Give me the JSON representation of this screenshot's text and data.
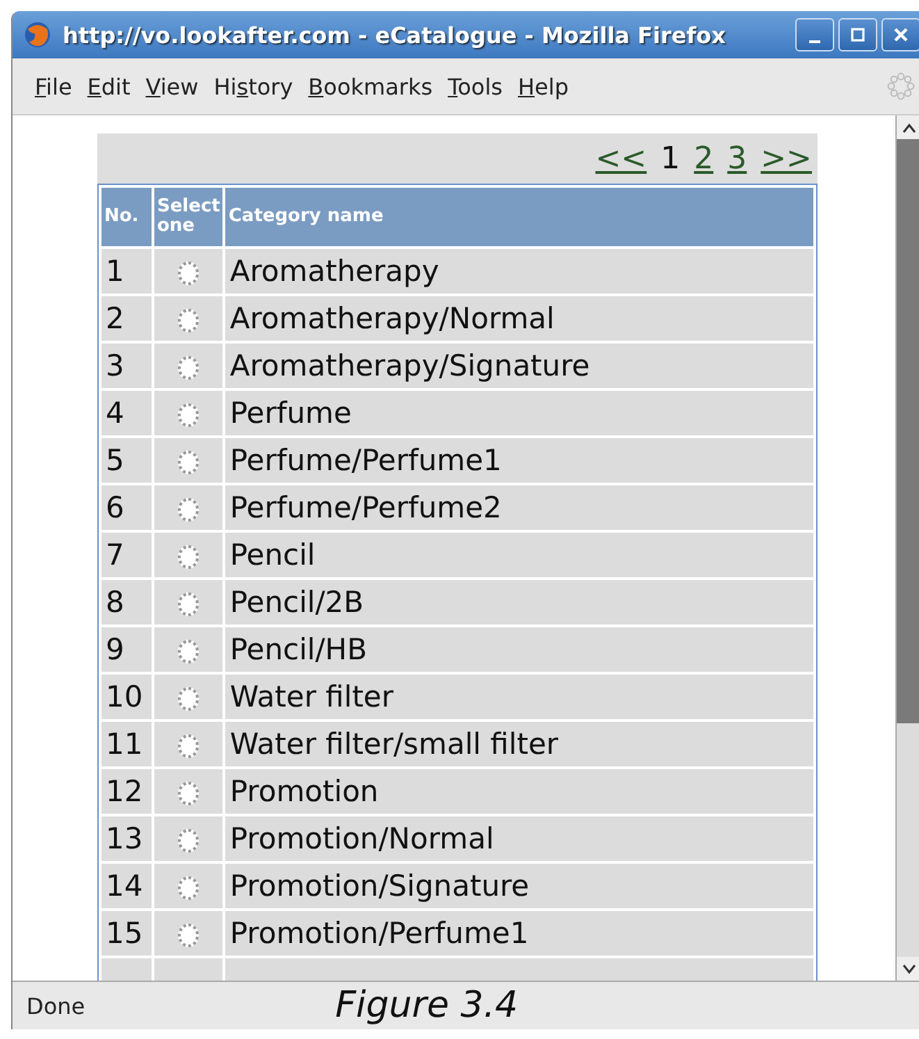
{
  "window": {
    "title": "http://vo.lookafter.com - eCatalogue - Mozilla Firefox",
    "controls": [
      {
        "kind": "minimize"
      },
      {
        "kind": "maximize"
      },
      {
        "kind": "close"
      }
    ]
  },
  "menu": [
    {
      "access_key": "F",
      "label_rest": "ile"
    },
    {
      "access_key": "E",
      "label_rest": "dit"
    },
    {
      "access_key": "V",
      "label_rest": "iew"
    },
    {
      "label_start": "Hi",
      "access_key": "s",
      "label_rest": "tory"
    },
    {
      "access_key": "B",
      "label_rest": "ookmarks"
    },
    {
      "access_key": "T",
      "label_rest": "ools"
    },
    {
      "access_key": "H",
      "label_rest": "elp"
    }
  ],
  "pager": [
    {
      "label": "<<",
      "kind": "link"
    },
    {
      "label": "1",
      "kind": "current"
    },
    {
      "label": "2",
      "kind": "link"
    },
    {
      "label": "3",
      "kind": "link"
    },
    {
      "label": ">>",
      "kind": "link"
    }
  ],
  "table": {
    "columns": [
      "No.",
      "Select one",
      "Category name"
    ],
    "rows": [
      {
        "no": "1",
        "name": "Aromatherapy",
        "selected": false
      },
      {
        "no": "2",
        "name": "Aromatherapy/Normal",
        "selected": false
      },
      {
        "no": "3",
        "name": "Aromatherapy/Signature",
        "selected": false
      },
      {
        "no": "4",
        "name": "Perfume",
        "selected": false
      },
      {
        "no": "5",
        "name": "Perfume/Perfume1",
        "selected": false
      },
      {
        "no": "6",
        "name": "Perfume/Perfume2",
        "selected": false
      },
      {
        "no": "7",
        "name": "Pencil",
        "selected": false
      },
      {
        "no": "8",
        "name": "Pencil/2B",
        "selected": false
      },
      {
        "no": "9",
        "name": "Pencil/HB",
        "selected": false
      },
      {
        "no": "10",
        "name": "Water filter",
        "selected": false
      },
      {
        "no": "11",
        "name": "Water filter/small filter",
        "selected": false
      },
      {
        "no": "12",
        "name": "Promotion",
        "selected": false
      },
      {
        "no": "13",
        "name": "Promotion/Normal",
        "selected": false
      },
      {
        "no": "14",
        "name": "Promotion/Signature",
        "selected": false
      },
      {
        "no": "15",
        "name": "Promotion/Perfume1",
        "selected": false
      }
    ]
  },
  "status_bar": {
    "text": "Done"
  },
  "caption": "Figure 3.4"
}
